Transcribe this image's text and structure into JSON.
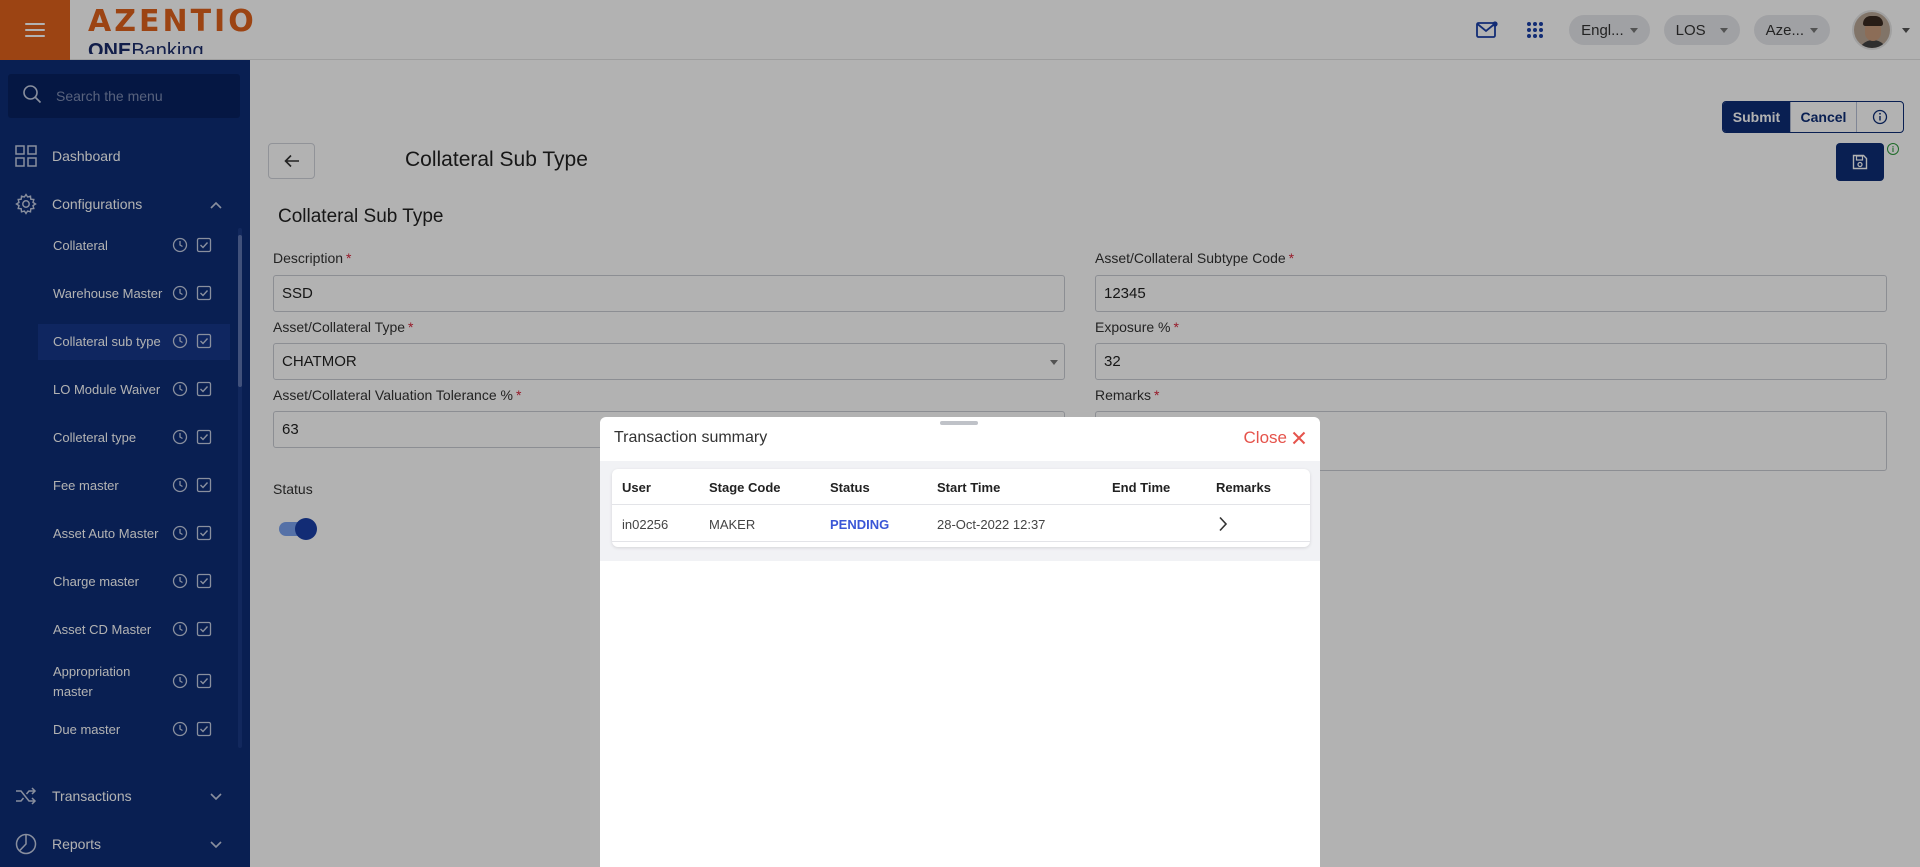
{
  "topbar": {
    "brand": "AZENTIO",
    "brand_sub_bold": "ONE",
    "brand_sub_rest": "Banking",
    "language": "Engl...",
    "module": "LOS",
    "entity": "Aze..."
  },
  "sidebar": {
    "search_placeholder": "Search the menu",
    "top_items": [
      {
        "label": "Dashboard",
        "icon": "dashboard-icon"
      },
      {
        "label": "Configurations",
        "icon": "gear-icon",
        "expanded": true
      }
    ],
    "config_items": [
      {
        "label": "Collateral"
      },
      {
        "label": "Warehouse Master"
      },
      {
        "label": "Collateral sub type",
        "active": true
      },
      {
        "label": "LO Module Waiver"
      },
      {
        "label": "Colleteral type"
      },
      {
        "label": "Fee master"
      },
      {
        "label": "Asset Auto Master"
      },
      {
        "label": "Charge master"
      },
      {
        "label": "Asset CD Master"
      },
      {
        "label": "Appropriation master"
      },
      {
        "label": "Due master"
      }
    ],
    "bottom_items": [
      {
        "label": "Transactions",
        "icon": "shuffle-icon"
      },
      {
        "label": "Reports",
        "icon": "pie-chart-icon"
      }
    ]
  },
  "main": {
    "page_title": "Collateral Sub Type",
    "submit_label": "Submit",
    "cancel_label": "Cancel",
    "section_title": "Collateral Sub Type",
    "fields": {
      "description": {
        "label": "Description",
        "value": "SSD"
      },
      "subtype_code": {
        "label": "Asset/Collateral Subtype Code",
        "value": "12345"
      },
      "collateral_type": {
        "label": "Asset/Collateral Type",
        "value": "CHATMOR"
      },
      "exposure": {
        "label": "Exposure %",
        "value": "32"
      },
      "valuation_tolerance": {
        "label": "Asset/Collateral Valuation Tolerance %",
        "value": "63"
      },
      "remarks": {
        "label": "Remarks",
        "value": ""
      },
      "status": {
        "label": "Status",
        "enabled": true
      }
    },
    "required_marker": "*"
  },
  "modal": {
    "title": "Transaction summary",
    "close_label": "Close",
    "columns": [
      "User",
      "Stage Code",
      "Status",
      "Start Time",
      "End Time",
      "Remarks"
    ],
    "rows": [
      {
        "user": "in02256",
        "stage_code": "MAKER",
        "status": "PENDING",
        "start_time": "28-Oct-2022 12:37",
        "end_time": "",
        "remarks": ""
      }
    ]
  },
  "colors": {
    "brand_orange": "#e0621c",
    "sidebar_navy": "#0d2d76",
    "pending_blue": "#3a56d6",
    "close_red": "#e5534b"
  }
}
